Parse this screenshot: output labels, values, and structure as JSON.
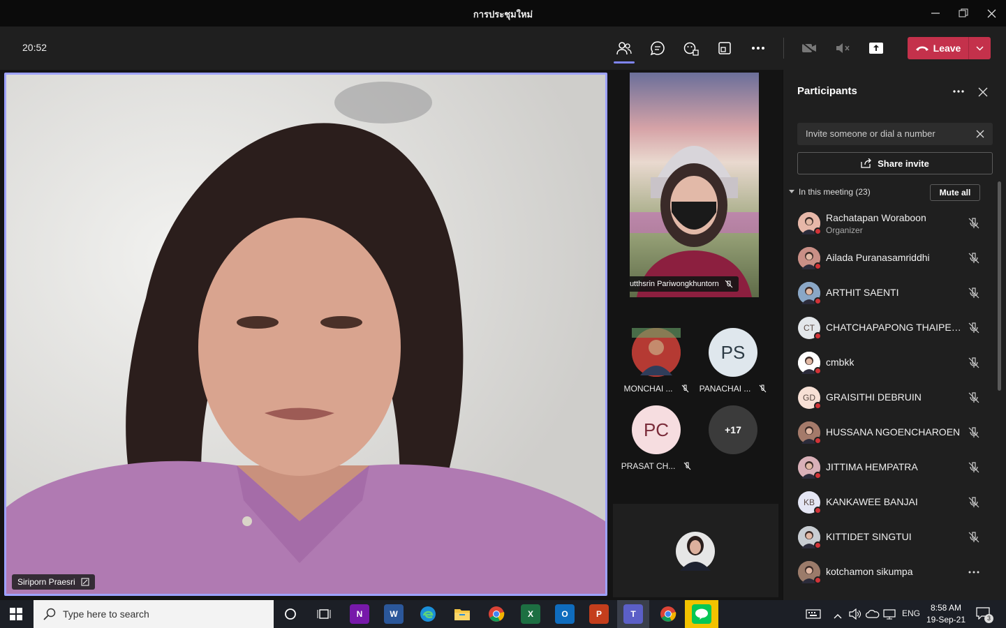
{
  "window": {
    "title": "การประชุมใหม่"
  },
  "meeting": {
    "timer": "20:52",
    "leave_label": "Leave"
  },
  "main_video": {
    "name": "Siriporn Praesri"
  },
  "side_video": {
    "name": "Nutthsrin Pariwongkhuntorn"
  },
  "gallery": [
    {
      "initials": "",
      "label": "MONCHAI ...",
      "bg": "#b03030"
    },
    {
      "initials": "PS",
      "label": "PANACHAI ...",
      "bg": "#dfe7ed"
    },
    {
      "initials": "PC",
      "label": "PRASAT CH...",
      "bg": "#f6dde0"
    },
    {
      "initials": "+17",
      "label": "",
      "bg": "#3b3b3b"
    }
  ],
  "panel": {
    "title": "Participants",
    "invite_placeholder": "Invite someone or dial a number",
    "share_label": "Share invite",
    "section_label": "In this meeting (23)",
    "mute_all_label": "Mute all",
    "participants": [
      {
        "name": "Rachatapan Woraboon",
        "role": "Organizer",
        "initials": "",
        "bg": "#e6b7a8"
      },
      {
        "name": "Ailada Puranasamriddhi",
        "role": "",
        "initials": "",
        "bg": "#c98f86"
      },
      {
        "name": "ARTHIT SAENTI",
        "role": "",
        "initials": "",
        "bg": "#8aa7c6"
      },
      {
        "name": "CHATCHAPAPONG THAIPETK...",
        "role": "",
        "initials": "CT",
        "bg": "#e3e7ea"
      },
      {
        "name": "cmbkk",
        "role": "",
        "initials": "",
        "bg": "#ffffff"
      },
      {
        "name": "GRAISITHI DEBRUIN",
        "role": "",
        "initials": "GD",
        "bg": "#f7e0d5"
      },
      {
        "name": "HUSSANA NGOENCHAROEN",
        "role": "",
        "initials": "",
        "bg": "#a47a6a"
      },
      {
        "name": "JITTIMA HEMPATRA",
        "role": "",
        "initials": "",
        "bg": "#d9b0b8"
      },
      {
        "name": "KANKAWEE BANJAI",
        "role": "",
        "initials": "KB",
        "bg": "#e4e6f4"
      },
      {
        "name": "KITTIDET SINGTUI",
        "role": "",
        "initials": "",
        "bg": "#c8cdd2"
      },
      {
        "name": "kotchamon sikumpa",
        "role": "",
        "initials": "",
        "bg": "#9b7b6a"
      }
    ]
  },
  "taskbar": {
    "search_placeholder": "Type here to search",
    "lang": "ENG",
    "time": "8:58 AM",
    "date": "19-Sep-21",
    "notifications": "3"
  }
}
